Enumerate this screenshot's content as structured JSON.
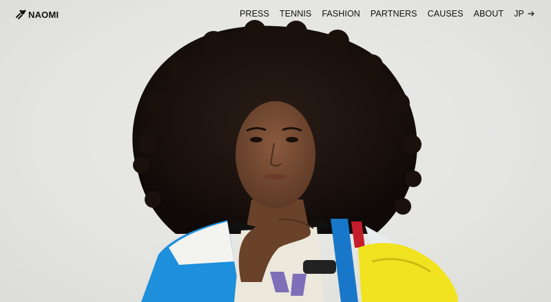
{
  "brand": {
    "name": "NAOMI",
    "logo_icon": "hair-silhouette-icon"
  },
  "nav": {
    "items": [
      {
        "label": "PRESS"
      },
      {
        "label": "TENNIS"
      },
      {
        "label": "FASHION"
      },
      {
        "label": "PARTNERS"
      },
      {
        "label": "CAUSES"
      },
      {
        "label": "ABOUT"
      }
    ],
    "language": {
      "label": "JP",
      "icon": "arrow-right-icon"
    }
  },
  "hero": {
    "image_subject": "portrait photo of a woman with curly hair",
    "background_color": "#e6e6e3"
  }
}
